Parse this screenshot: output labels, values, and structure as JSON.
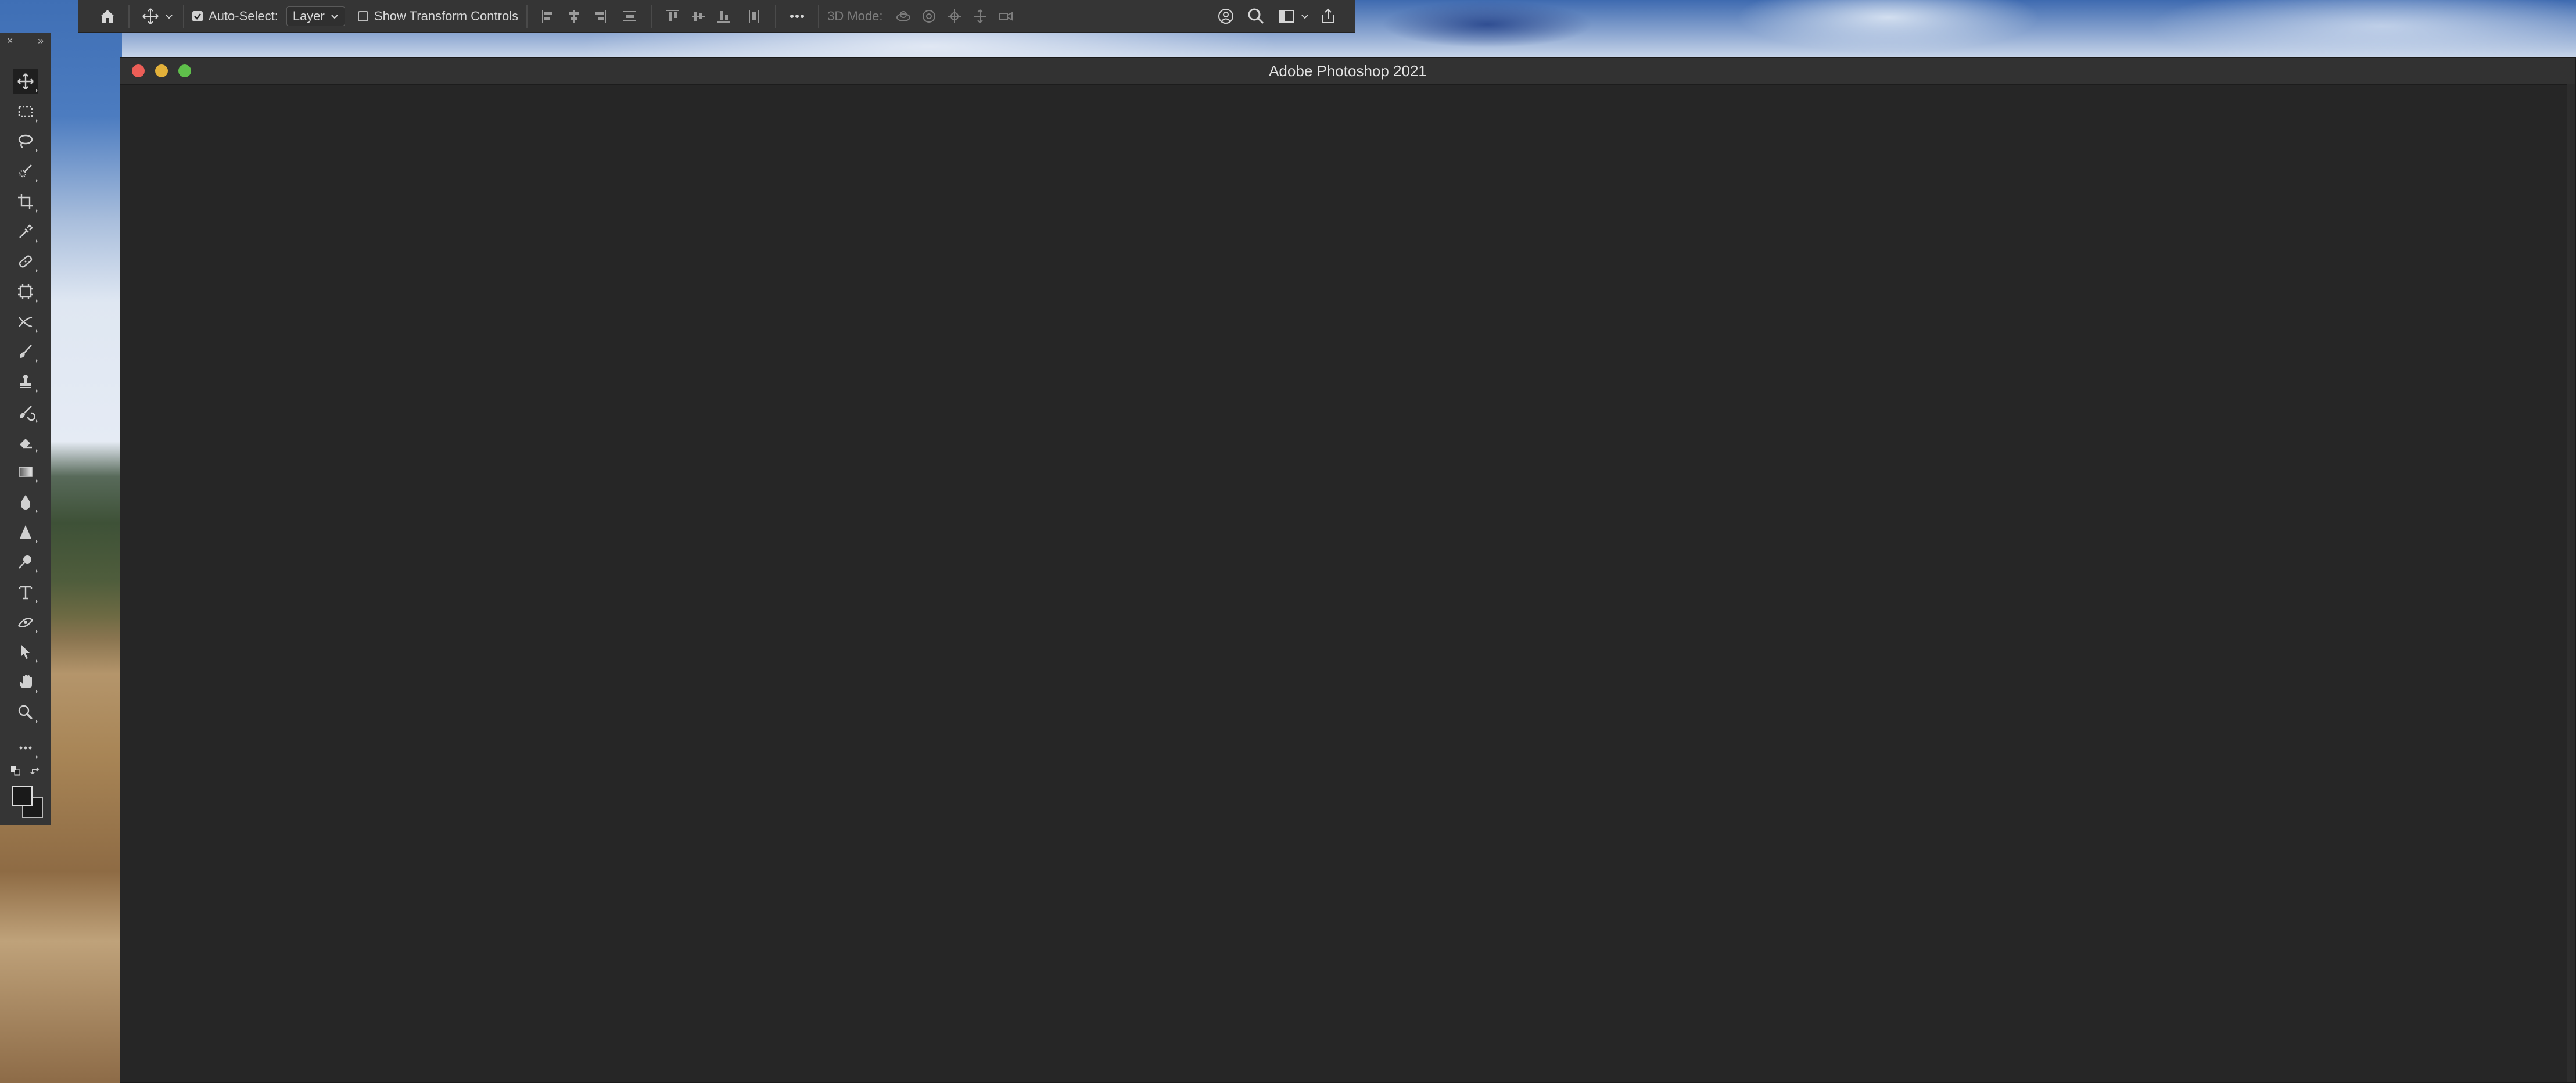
{
  "app": {
    "title": "Adobe Photoshop 2021"
  },
  "options_bar": {
    "auto_select_label": "Auto-Select:",
    "auto_select_checked": true,
    "auto_select_target": "Layer",
    "show_transform_label": "Show Transform Controls",
    "show_transform_checked": false,
    "mode_3d_label": "3D Mode:"
  },
  "tool_panel": {
    "collapse_glyph": "×",
    "expand_glyph": "»",
    "tools": [
      {
        "name": "move-tool",
        "icon": "move-icon"
      },
      {
        "name": "rectangular-marquee-tool",
        "icon": "marquee-icon"
      },
      {
        "name": "lasso-tool",
        "icon": "lasso-icon"
      },
      {
        "name": "quick-selection-tool",
        "icon": "quick-selection-icon"
      },
      {
        "name": "crop-tool",
        "icon": "crop-icon"
      },
      {
        "name": "eyedropper-tool",
        "icon": "eyedropper-icon"
      },
      {
        "name": "spot-healing-tool",
        "icon": "bandage-icon"
      },
      {
        "name": "frame-tool",
        "icon": "frame-icon"
      },
      {
        "name": "content-aware-move-tool",
        "icon": "cross-arrows-icon"
      },
      {
        "name": "brush-tool",
        "icon": "brush-icon"
      },
      {
        "name": "clone-stamp-tool",
        "icon": "stamp-icon"
      },
      {
        "name": "history-brush-tool",
        "icon": "history-brush-icon"
      },
      {
        "name": "eraser-tool",
        "icon": "eraser-icon"
      },
      {
        "name": "gradient-tool",
        "icon": "gradient-icon"
      },
      {
        "name": "blur-tool",
        "icon": "drop-icon"
      },
      {
        "name": "sharpen-tool",
        "icon": "triangle-icon"
      },
      {
        "name": "dodge-tool",
        "icon": "dodge-icon"
      },
      {
        "name": "type-tool",
        "icon": "type-icon"
      },
      {
        "name": "pen-tool",
        "icon": "pen-icon"
      },
      {
        "name": "path-selection-tool",
        "icon": "arrow-icon"
      },
      {
        "name": "hand-tool",
        "icon": "hand-icon"
      },
      {
        "name": "zoom-tool",
        "icon": "zoom-icon"
      },
      {
        "name": "edit-toolbar",
        "icon": "ellipsis-icon"
      }
    ],
    "foreground_color": "#1a1a1a",
    "background_color": "#1a1a1a"
  },
  "colors": {
    "chrome": "#353535",
    "window_bg": "#262626",
    "close": "#ec5e57",
    "minimize": "#e3b13a",
    "zoom": "#5fc04b"
  }
}
